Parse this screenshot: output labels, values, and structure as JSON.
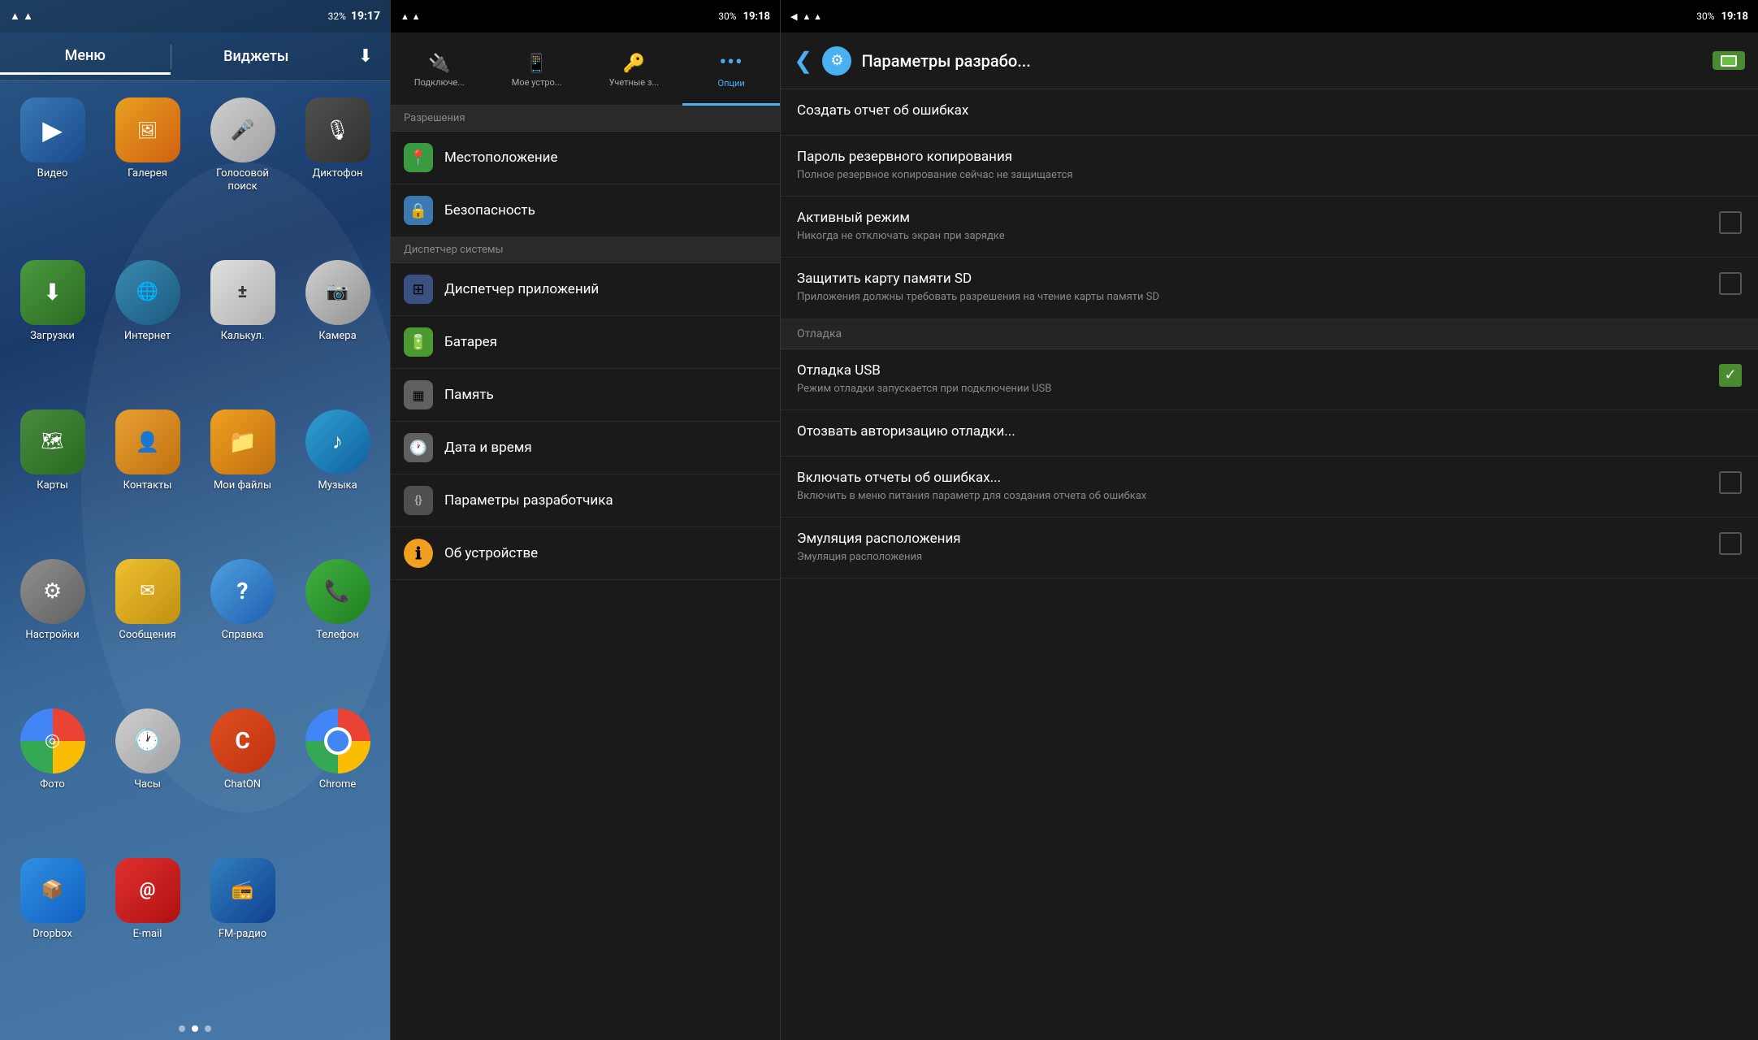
{
  "homeScreen": {
    "statusBar": {
      "time": "19:17",
      "batteryPercent": "32%",
      "wifi": "▲",
      "signal": "||||"
    },
    "tabs": [
      {
        "label": "Меню",
        "active": true
      },
      {
        "label": "Виджеты",
        "active": false
      }
    ],
    "downloadTabIcon": "⬇",
    "apps": [
      {
        "id": "video",
        "label": "Видео",
        "icon": "▶",
        "iconClass": "icon-video"
      },
      {
        "id": "gallery",
        "label": "Галерея",
        "icon": "🖼",
        "iconClass": "icon-gallery"
      },
      {
        "id": "voice",
        "label": "Голосовой поиск",
        "icon": "🎤",
        "iconClass": "icon-voice"
      },
      {
        "id": "dictaphone",
        "label": "Диктофон",
        "icon": "🎙",
        "iconClass": "icon-dictaphone"
      },
      {
        "id": "downloads",
        "label": "Загрузки",
        "icon": "⬇",
        "iconClass": "icon-downloads"
      },
      {
        "id": "internet",
        "label": "Интернет",
        "icon": "🌐",
        "iconClass": "icon-internet"
      },
      {
        "id": "calc",
        "label": "Калькул.",
        "icon": "±",
        "iconClass": "icon-calc"
      },
      {
        "id": "camera",
        "label": "Камера",
        "icon": "📷",
        "iconClass": "icon-camera"
      },
      {
        "id": "maps",
        "label": "Карты",
        "icon": "🗺",
        "iconClass": "icon-maps"
      },
      {
        "id": "contacts",
        "label": "Контакты",
        "icon": "👤",
        "iconClass": "icon-contacts"
      },
      {
        "id": "myfiles",
        "label": "Мои файлы",
        "icon": "📁",
        "iconClass": "icon-myfiles"
      },
      {
        "id": "music",
        "label": "Музыка",
        "icon": "♪",
        "iconClass": "icon-music"
      },
      {
        "id": "settings",
        "label": "Настройки",
        "icon": "⚙",
        "iconClass": "icon-settings"
      },
      {
        "id": "messages",
        "label": "Сообщения",
        "icon": "✉",
        "iconClass": "icon-messages"
      },
      {
        "id": "help",
        "label": "Справка",
        "icon": "?",
        "iconClass": "icon-help"
      },
      {
        "id": "phone",
        "label": "Телефон",
        "icon": "📞",
        "iconClass": "icon-phone"
      },
      {
        "id": "photos",
        "label": "Фото",
        "icon": "◎",
        "iconClass": "icon-photos"
      },
      {
        "id": "clock",
        "label": "Часы",
        "icon": "🕐",
        "iconClass": "icon-clock"
      },
      {
        "id": "chaton",
        "label": "ChatON",
        "icon": "C",
        "iconClass": "icon-chaton"
      },
      {
        "id": "chrome",
        "label": "Chrome",
        "icon": "◎",
        "iconClass": "icon-chrome"
      },
      {
        "id": "dropbox",
        "label": "Dropbox",
        "icon": "📦",
        "iconClass": "icon-dropbox"
      },
      {
        "id": "email",
        "label": "E-mail",
        "icon": "@",
        "iconClass": "icon-email"
      },
      {
        "id": "fmradio",
        "label": "FM-радио",
        "icon": "📻",
        "iconClass": "icon-fmradio"
      }
    ],
    "dots": [
      false,
      true,
      false
    ]
  },
  "settingsPanel": {
    "statusBar": {
      "time": "19:18",
      "batteryPercent": "30%"
    },
    "tabs": [
      {
        "label": "Подключе...",
        "icon": "🔌",
        "active": false
      },
      {
        "label": "Мое устро...",
        "icon": "📱",
        "active": false
      },
      {
        "label": "Учетные з...",
        "icon": "🔑",
        "active": false
      },
      {
        "label": "Опции",
        "icon": "⋯",
        "active": true
      }
    ],
    "sectionHeader": "Разрешения",
    "items": [
      {
        "id": "location",
        "label": "Местоположение",
        "iconColor": "#3a9a40",
        "icon": "📍"
      },
      {
        "id": "security",
        "label": "Безопасность",
        "iconColor": "#3a7ab0",
        "icon": "🔒"
      },
      {
        "id": "sysmanager",
        "label": "Диспетчер системы",
        "iconColor": "",
        "icon": "",
        "isHeader": true
      },
      {
        "id": "appmanager",
        "label": "Диспетчер приложений",
        "iconColor": "#3a7ab0",
        "icon": "⊞"
      },
      {
        "id": "battery",
        "label": "Батарея",
        "iconColor": "#4a9a30",
        "icon": "🔋"
      },
      {
        "id": "memory",
        "label": "Память",
        "iconColor": "#909090",
        "icon": "💾"
      },
      {
        "id": "datetime",
        "label": "Дата и время",
        "iconColor": "#909090",
        "icon": "🕐"
      },
      {
        "id": "devopt",
        "label": "Параметры разработчика",
        "iconColor": "#505050",
        "icon": "{}"
      },
      {
        "id": "about",
        "label": "Об устройстве",
        "iconColor": "#f0a020",
        "icon": "ℹ"
      }
    ]
  },
  "developerPanel": {
    "statusBar": {
      "time": "19:18",
      "batteryPercent": "30%"
    },
    "header": {
      "backIcon": "❮",
      "title": "Параметры разрабо...",
      "battery": "I"
    },
    "items": [
      {
        "id": "create-report",
        "title": "Создать отчет об ошибках",
        "subtitle": "",
        "hasCheckbox": false,
        "checked": false,
        "isSection": false
      },
      {
        "id": "backup-password",
        "title": "Пароль резервного копирования",
        "subtitle": "Полное резервное копирование сейчас не защищается",
        "hasCheckbox": false,
        "checked": false,
        "isSection": false
      },
      {
        "id": "active-mode",
        "title": "Активный режим",
        "subtitle": "Никогда не отключать экран при зарядке",
        "hasCheckbox": true,
        "checked": false,
        "isSection": false
      },
      {
        "id": "protect-sd",
        "title": "Защитить карту памяти SD",
        "subtitle": "Приложения должны требовать разрешения на чтение карты памяти SD",
        "hasCheckbox": true,
        "checked": false,
        "isSection": false
      },
      {
        "id": "debug-section",
        "title": "Отладка",
        "subtitle": "",
        "hasCheckbox": false,
        "checked": false,
        "isSection": true
      },
      {
        "id": "usb-debug",
        "title": "Отладка USB",
        "subtitle": "Режим отладки запускается при подключении USB",
        "hasCheckbox": true,
        "checked": true,
        "isSection": false
      },
      {
        "id": "revoke-debug",
        "title": "Отозвать авторизацию отладки...",
        "subtitle": "",
        "hasCheckbox": false,
        "checked": false,
        "isSection": false
      },
      {
        "id": "error-reports",
        "title": "Включать отчеты об ошибках...",
        "subtitle": "Включить в меню питания параметр для создания отчета об ошибках",
        "hasCheckbox": true,
        "checked": false,
        "isSection": false
      },
      {
        "id": "mock-location",
        "title": "Эмуляция расположения",
        "subtitle": "Эмуляция расположения",
        "hasCheckbox": true,
        "checked": false,
        "isSection": false
      }
    ]
  }
}
